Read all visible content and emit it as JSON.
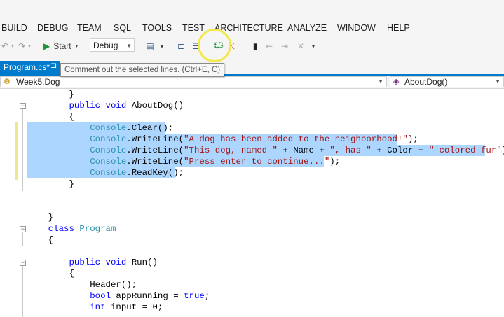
{
  "menu": [
    "BUILD",
    "DEBUG",
    "TEAM",
    "SQL",
    "TOOLS",
    "TEST",
    "ARCHITECTURE",
    "ANALYZE",
    "WINDOW",
    "HELP"
  ],
  "toolbar": {
    "start_label": "Start",
    "config_value": "Debug"
  },
  "tab": {
    "label": "Program.cs*"
  },
  "tooltip": "Comment out the selected lines. (Ctrl+E, C)",
  "nav": {
    "type_value": "Week5.Dog",
    "member_value": "AboutDog()"
  },
  "code": [
    "        }",
    "        public void AboutDog()",
    "        {",
    "            Console.Clear();",
    "            Console.WriteLine(\"A dog has been added to the neighborhood!\");",
    "            Console.WriteLine(\"This dog, named \" + Name + \", has \" + Color + \" colored fur\");",
    "            Console.WriteLine(\"Press enter to continue...\");",
    "            Console.ReadKey();",
    "        }",
    "",
    "",
    "    }",
    "    class Program",
    "    {",
    "",
    "        public void Run()",
    "        {",
    "            Header();",
    "            bool appRunning = true;",
    "            int input = 0;"
  ],
  "colors": {
    "accent": "#007acc",
    "selection": "#add6ff",
    "keyword": "#0000ff",
    "type": "#2b91af",
    "string": "#a31515"
  }
}
